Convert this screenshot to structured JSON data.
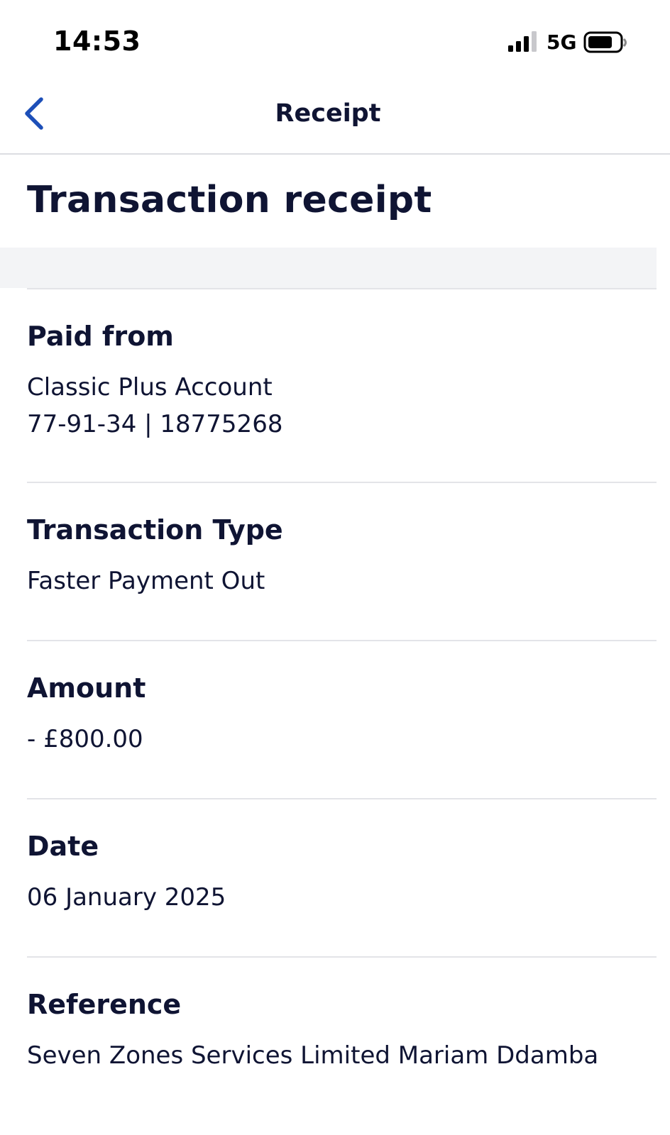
{
  "status_bar": {
    "time": "14:53",
    "network": "5G",
    "signal_icon": "cellular-signal-icon",
    "battery_icon": "battery-icon"
  },
  "nav": {
    "back_icon": "chevron-left-icon",
    "title": "Receipt",
    "accent_color": "#1d4fb8"
  },
  "page": {
    "title": "Transaction receipt"
  },
  "sections": {
    "paid_from": {
      "label": "Paid from",
      "account_name": "Classic Plus Account",
      "account_details": "77-91-34 | 18775268"
    },
    "transaction_type": {
      "label": "Transaction Type",
      "value": "Faster Payment Out"
    },
    "amount": {
      "label": "Amount",
      "value": "- £800.00"
    },
    "date": {
      "label": "Date",
      "value": "06 January 2025"
    },
    "reference": {
      "label": "Reference",
      "value": "Seven Zones Services Limited Mariam Ddamba"
    }
  },
  "colors": {
    "text_primary": "#0f1433",
    "divider": "#e3e4e8",
    "band": "#f3f4f6"
  }
}
